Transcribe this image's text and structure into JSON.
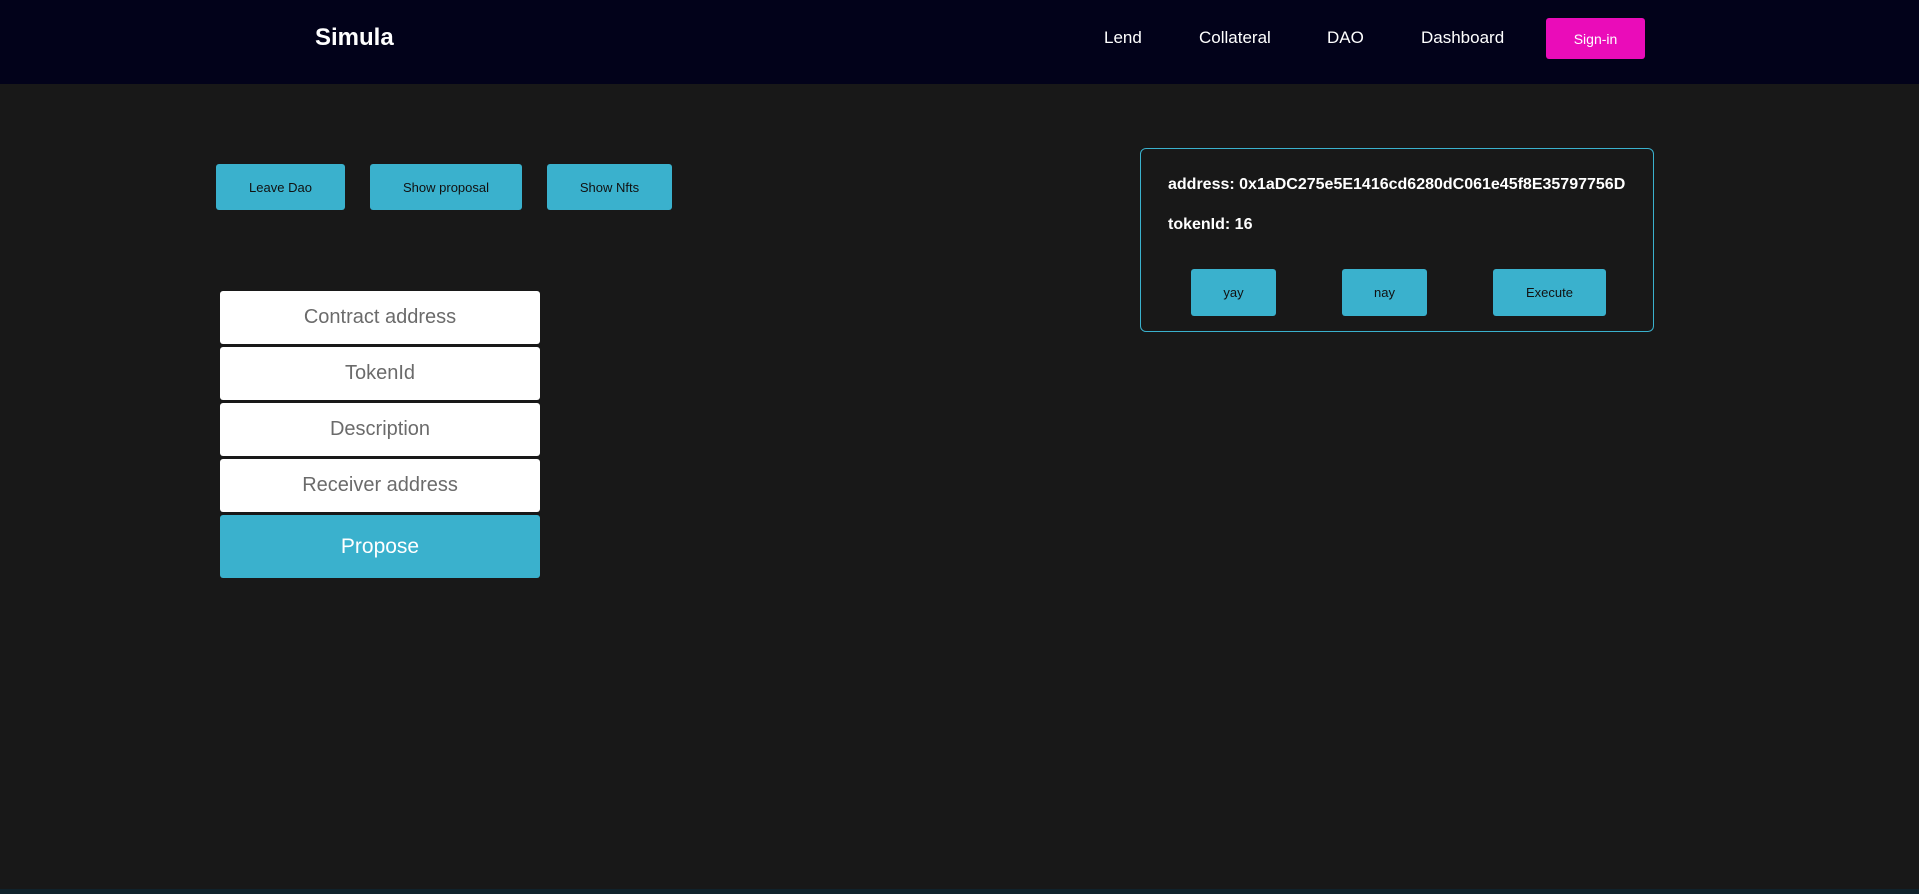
{
  "header": {
    "brand": "Simula",
    "nav": [
      "Lend",
      "Collateral",
      "DAO",
      "Dashboard"
    ],
    "signin_label": "Sign-in"
  },
  "actions": {
    "leave_dao": "Leave Dao",
    "show_proposal": "Show proposal",
    "show_nfts": "Show Nfts"
  },
  "form": {
    "contract_placeholder": "Contract address",
    "token_placeholder": "TokenId",
    "description_placeholder": "Description",
    "receiver_placeholder": "Receiver address",
    "propose_label": "Propose"
  },
  "proposal": {
    "address_label": "address:",
    "address": "0x1aDC275e5E1416cd6280dC061e45f8E35797756D",
    "tokenid_label": "tokenId:",
    "tokenid": "16",
    "yay_label": "yay",
    "nay_label": "nay",
    "execute_label": "Execute"
  },
  "colors": {
    "navbar": "#02021a",
    "background": "#181818",
    "accent": "#3ab1cd",
    "signin": "#ea0cb9"
  }
}
